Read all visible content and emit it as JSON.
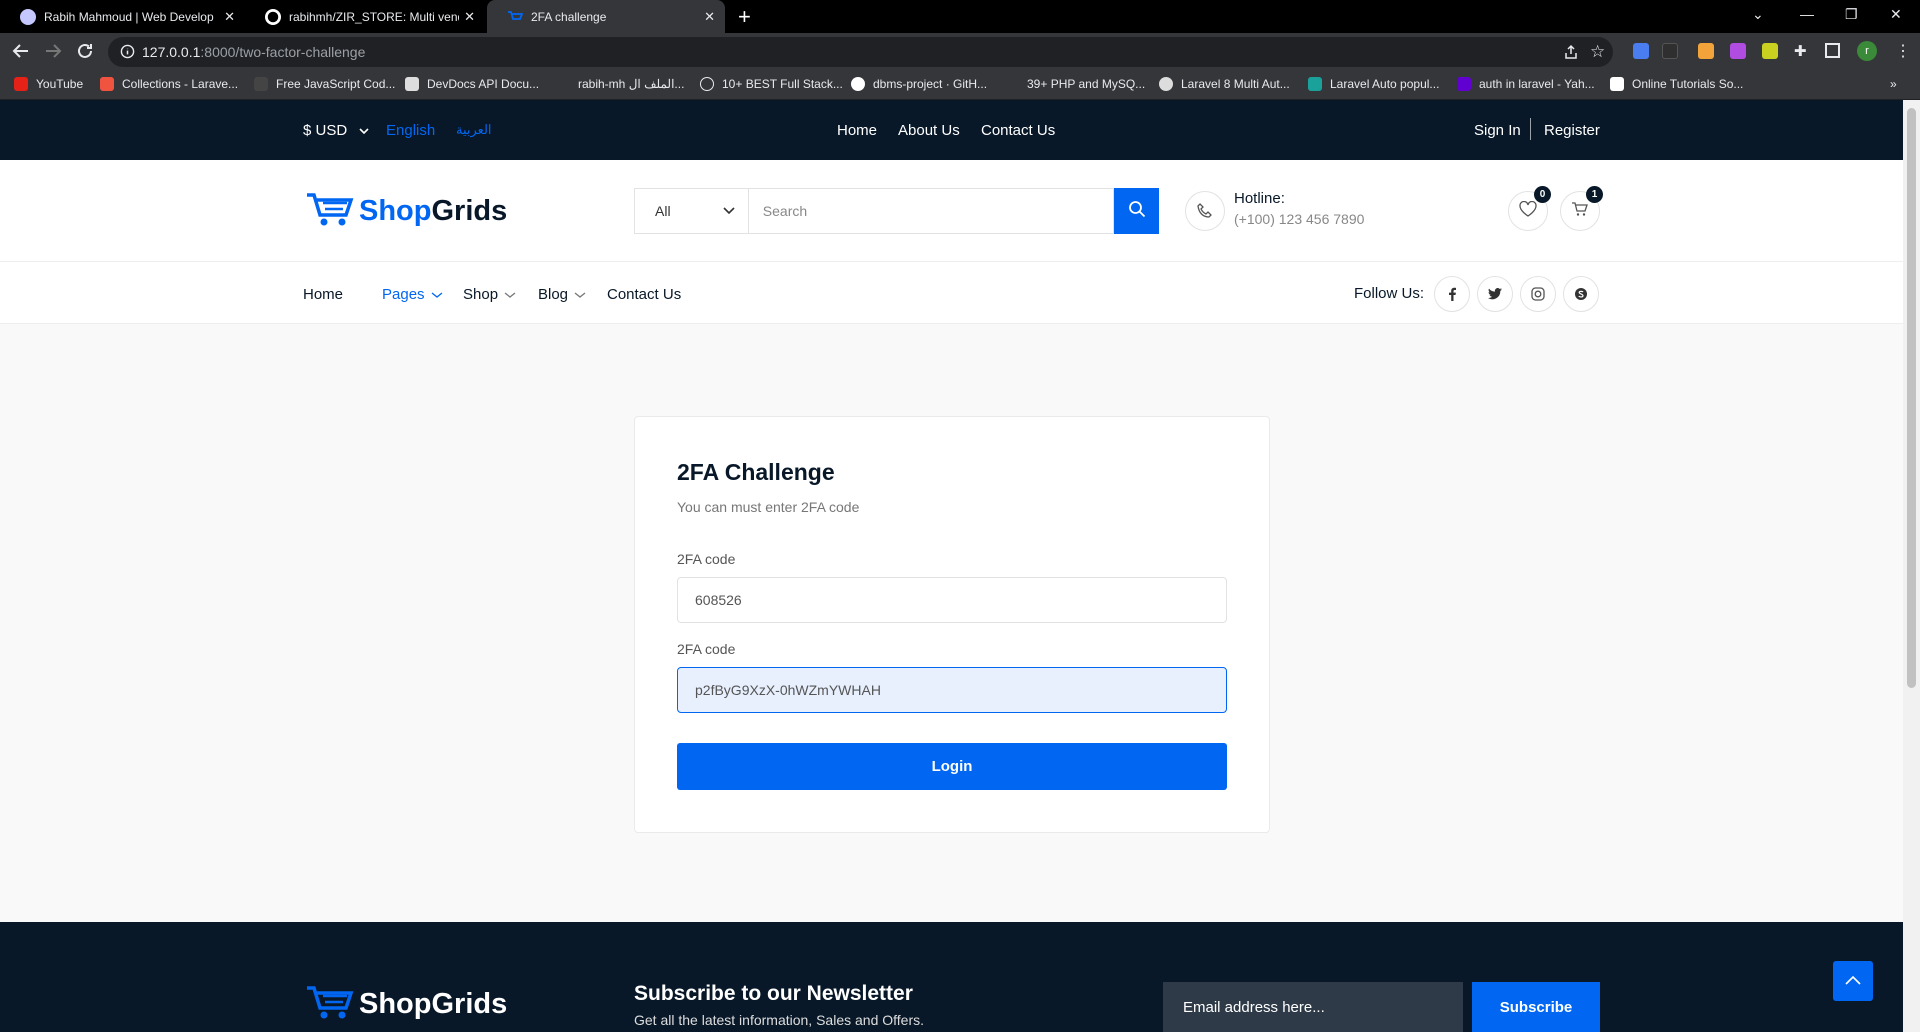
{
  "browser": {
    "tabs": [
      {
        "title": "Rabih Mahmoud | Web Developer"
      },
      {
        "title": "rabihmh/ZIR_STORE: Multi vendor"
      },
      {
        "title": "2FA challenge"
      }
    ],
    "url_host": "127.0.0.1",
    "url_path": ":8000/two-factor-challenge",
    "bookmarks": [
      "YouTube",
      "Collections - Larave...",
      "Free JavaScript Cod...",
      "DevDocs API Docu...",
      "rabih-mh الملف ال...",
      "10+ BEST Full Stack...",
      "dbms-project · GitH...",
      "39+ PHP and MySQ...",
      "Laravel 8 Multi Aut...",
      "Laravel Auto popul...",
      "auth in laravel - Yah...",
      "Online Tutorials So..."
    ],
    "profile_initial": "r"
  },
  "topbar": {
    "currency": "$ USD",
    "lang_en": "English",
    "lang_ar": "العربية",
    "links": [
      "Home",
      "About Us",
      "Contact Us"
    ],
    "sign_in": "Sign In",
    "register": "Register"
  },
  "header": {
    "logo_a": "Shop",
    "logo_b": "Grids",
    "category": "All",
    "search_placeholder": "Search",
    "hotline_label": "Hotline:",
    "hotline_number": "(+100) 123 456 7890",
    "wishlist_count": "0",
    "cart_count": "1"
  },
  "nav": {
    "items": [
      "Home",
      "Pages",
      "Shop",
      "Blog",
      "Contact Us"
    ],
    "follow": "Follow Us:"
  },
  "form": {
    "title": "2FA Challenge",
    "subtitle": "You can must enter 2FA code",
    "label1": "2FA code",
    "value1": "608526",
    "label2": "2FA code",
    "value2": "p2fByG9XzX-0hWZmYWHAH",
    "button": "Login"
  },
  "footer": {
    "logo_a": "Shop",
    "logo_b": "Grids",
    "title": "Subscribe to our Newsletter",
    "subtitle": "Get all the latest information, Sales and Offers.",
    "email_placeholder": "Email address here...",
    "subscribe": "Subscribe"
  },
  "colors": {
    "accent": "#0167f3",
    "dark": "#081828"
  }
}
